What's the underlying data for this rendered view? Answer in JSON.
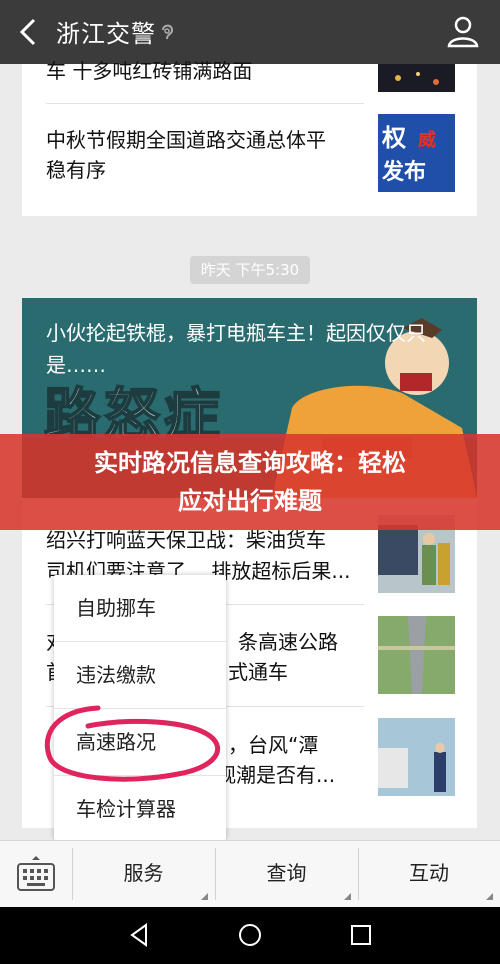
{
  "header": {
    "title": "浙江交警",
    "back_icon": "back-chevron-icon",
    "ear_icon": "ear-icon",
    "user_icon": "user-profile-icon"
  },
  "articles_top": [
    {
      "title_line1": "车 十多吨红砖铺满路面",
      "thumb": "night-road-thumb"
    },
    {
      "title_line1": "中秋节假期全国道路交通总体平",
      "title_line2": "稳有序",
      "thumb_badge_1": "权",
      "thumb_badge_2": "威",
      "thumb_badge_3": "发布"
    }
  ],
  "time_badge": "昨天 下午5:30",
  "hero_article": {
    "title_line1": "小伙抡起铁棍，暴打电瓶车主！起因仅仅只",
    "title_line2": "是……",
    "graphic_text": "路怒症"
  },
  "banner": {
    "text_line1": "实时路况信息查询攻略：轻松",
    "text_line2": "应对出行难题"
  },
  "articles_list": [
    {
      "title_line1": "绍兴打响蓝天保卫战：柴油货车",
      "title_line2": "司机们要注意了... 排放超标后果..."
    },
    {
      "title_line1": "对",
      "title_line1_right": "条高速公路",
      "title_line2": "首",
      "title_line2_right": "式通车"
    },
    {
      "title_line1_right": "，台风“潭",
      "title_line2_right": "观潮是否有..."
    }
  ],
  "popup_menu": {
    "items": [
      "自助挪车",
      "违法缴款",
      "高速路况",
      "车检计算器"
    ],
    "highlight_color": "#e0245e"
  },
  "bottom_menu": {
    "keyboard_icon": "keyboard-icon",
    "items": [
      "服务",
      "查询",
      "互动"
    ]
  },
  "android_nav": {
    "back": "nav-back-icon",
    "home": "nav-home-icon",
    "recents": "nav-recents-icon"
  },
  "colors": {
    "topbar": "#3b3b3b",
    "banner": "#d7372d",
    "hero_bg": "#2a6b70"
  }
}
